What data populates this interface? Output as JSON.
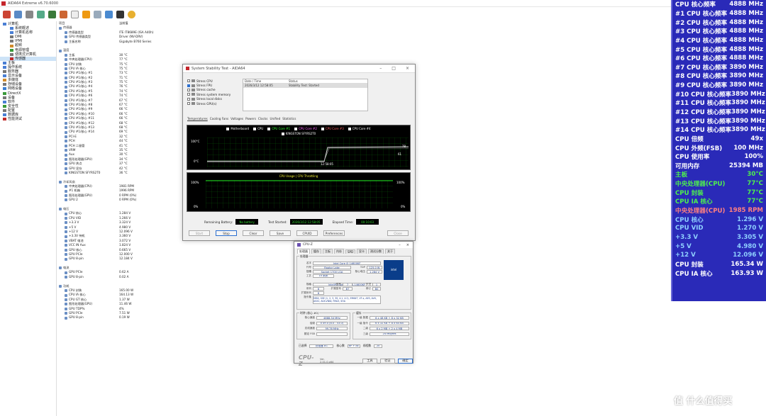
{
  "window": {
    "title": "AIDA64 Extreme v6.70.6000"
  },
  "tree": [
    {
      "label": "计算机",
      "level": 0,
      "color": "#4a7fd4"
    },
    {
      "label": "系统概述",
      "level": 1,
      "color": "#4a7fd4"
    },
    {
      "label": "计算机名称",
      "level": 1,
      "color": "#4a7fd4"
    },
    {
      "label": "DMI",
      "level": 1,
      "color": "#777"
    },
    {
      "label": "IPMI",
      "level": 1,
      "color": "#777"
    },
    {
      "label": "超频",
      "level": 1,
      "color": "#d08a2a"
    },
    {
      "label": "电源管理",
      "level": 1,
      "color": "#3a9a3a"
    },
    {
      "label": "便携式计算机",
      "level": 1,
      "color": "#777"
    },
    {
      "label": "传感器",
      "level": 1,
      "color": "#c02a2a",
      "selected": true
    },
    {
      "label": "主板",
      "level": 0,
      "color": "#4a7fd4"
    },
    {
      "label": "操作系统",
      "level": 0,
      "color": "#4a7fd4"
    },
    {
      "label": "服务器",
      "level": 0,
      "color": "#777"
    },
    {
      "label": "显示设备",
      "level": 0,
      "color": "#4a7fd4"
    },
    {
      "label": "多媒体",
      "level": 0,
      "color": "#d08a2a"
    },
    {
      "label": "存储设备",
      "level": 0,
      "color": "#777"
    },
    {
      "label": "网络设备",
      "level": 0,
      "color": "#3a7fd4"
    },
    {
      "label": "DirectX",
      "level": 0,
      "color": "#3a9a3a"
    },
    {
      "label": "设备",
      "level": 0,
      "color": "#777"
    },
    {
      "label": "软件",
      "level": 0,
      "color": "#4a7fd4"
    },
    {
      "label": "安全性",
      "level": 0,
      "color": "#3a9a3a"
    },
    {
      "label": "配置",
      "level": 0,
      "color": "#777"
    },
    {
      "label": "数据库",
      "level": 0,
      "color": "#4a7fd4"
    },
    {
      "label": "性能测试",
      "level": 0,
      "color": "#c02a2a"
    }
  ],
  "list": {
    "col_headers": [
      "项目",
      "当前值"
    ],
    "rows": [
      {
        "t": "h",
        "l": "传感器"
      },
      {
        "t": "r",
        "l": "传感器类型",
        "v": "ITE IT8689E (ISA A40h)"
      },
      {
        "t": "r",
        "l": "GPU 传感器类型",
        "v": "Driver (NV-DRV)"
      },
      {
        "t": "r",
        "l": "主板名称",
        "v": "Gigabyte B760 Series"
      },
      {
        "t": "s"
      },
      {
        "t": "h",
        "l": "温度"
      },
      {
        "t": "r",
        "l": "主板",
        "v": "30 °C"
      },
      {
        "t": "r",
        "l": "中央处理器(CPU)",
        "v": "77 °C"
      },
      {
        "t": "r",
        "l": "CPU 封装",
        "v": "75 °C"
      },
      {
        "t": "r",
        "l": "CPU IA 核心",
        "v": "75 °C"
      },
      {
        "t": "r",
        "l": "CPU #1/核心 #1",
        "v": "73 °C"
      },
      {
        "t": "r",
        "l": "CPU #1/核心 #2",
        "v": "71 °C"
      },
      {
        "t": "r",
        "l": "CPU #1/核心 #3",
        "v": "75 °C"
      },
      {
        "t": "r",
        "l": "CPU #1/核心 #4",
        "v": "76 °C"
      },
      {
        "t": "r",
        "l": "CPU #1/核心 #5",
        "v": "74 °C"
      },
      {
        "t": "r",
        "l": "CPU #1/核心 #6",
        "v": "74 °C"
      },
      {
        "t": "r",
        "l": "CPU #1/核心 #7",
        "v": "67 °C"
      },
      {
        "t": "r",
        "l": "CPU #1/核心 #8",
        "v": "67 °C"
      },
      {
        "t": "r",
        "l": "CPU #1/核心 #9",
        "v": "66 °C"
      },
      {
        "t": "r",
        "l": "CPU #1/核心 #10",
        "v": "66 °C"
      },
      {
        "t": "r",
        "l": "CPU #1/核心 #11",
        "v": "66 °C"
      },
      {
        "t": "r",
        "l": "CPU #1/核心 #12",
        "v": "68 °C"
      },
      {
        "t": "r",
        "l": "CPU #1/核心 #13",
        "v": "68 °C"
      },
      {
        "t": "r",
        "l": "CPU #1/核心 #14",
        "v": "69 °C"
      },
      {
        "t": "r",
        "l": "PCI-E",
        "v": "32 °C"
      },
      {
        "t": "r",
        "l": "PCH",
        "v": "44 °C"
      },
      {
        "t": "r",
        "l": "PCH 二极管",
        "v": "41 °C"
      },
      {
        "t": "r",
        "l": "VRM",
        "v": "35 °C"
      },
      {
        "t": "r",
        "l": "Aux",
        "v": "30 °C"
      },
      {
        "t": "r",
        "l": "图形处理器(GPU)",
        "v": "34 °C"
      },
      {
        "t": "r",
        "l": "GPU 热点",
        "v": "37 °C"
      },
      {
        "t": "r",
        "l": "GPU 显存",
        "v": "42 °C"
      },
      {
        "t": "r",
        "l": "KINGSTON SFYRS2T0",
        "v": "36 °C"
      },
      {
        "t": "s"
      },
      {
        "t": "h",
        "l": "冷却风扇"
      },
      {
        "t": "r",
        "l": "中央处理器(CPU)",
        "v": "1981 RPM"
      },
      {
        "t": "r",
        "l": "#1 机箱",
        "v": "1996 RPM"
      },
      {
        "t": "r",
        "l": "图形处理器(GPU)",
        "v": "0 RPM  (0%)"
      },
      {
        "t": "r",
        "l": "GPU 2",
        "v": "0 RPM  (0%)"
      },
      {
        "t": "s"
      },
      {
        "t": "h",
        "l": "电压"
      },
      {
        "t": "r",
        "l": "CPU 核心",
        "v": "1.284 V"
      },
      {
        "t": "r",
        "l": "CPU VID",
        "v": "1.266 V"
      },
      {
        "t": "r",
        "l": "+3.3 V",
        "v": "3.324 V"
      },
      {
        "t": "r",
        "l": "+5 V",
        "v": "4.980 V"
      },
      {
        "t": "r",
        "l": "+12 V",
        "v": "12.096 V"
      },
      {
        "t": "r",
        "l": "+3.3V 待机",
        "v": "3.360 V"
      },
      {
        "t": "r",
        "l": "VBAT 电池",
        "v": "3.072 V"
      },
      {
        "t": "r",
        "l": "VCC IN Aux",
        "v": "1.824 V"
      },
      {
        "t": "r",
        "l": "GPU 核心",
        "v": "0.665 V"
      },
      {
        "t": "r",
        "l": "GPU PCIe",
        "v": "12.000 V"
      },
      {
        "t": "r",
        "l": "GPU 8-pin",
        "v": "12.184 V"
      },
      {
        "t": "s"
      },
      {
        "t": "h",
        "l": "电流"
      },
      {
        "t": "r",
        "l": "GPU PCIe",
        "v": "0.62 A"
      },
      {
        "t": "r",
        "l": "GPU 8-pin",
        "v": "0.02 A"
      },
      {
        "t": "s"
      },
      {
        "t": "h",
        "l": "功耗"
      },
      {
        "t": "r",
        "l": "CPU 封装",
        "v": "165.00 W"
      },
      {
        "t": "r",
        "l": "CPU IA 核心",
        "v": "164.13 W"
      },
      {
        "t": "r",
        "l": "CPU GT 核心",
        "v": "1.37 W"
      },
      {
        "t": "r",
        "l": "图形处理器(GPU)",
        "v": "11.46 W"
      },
      {
        "t": "r",
        "l": "GPU TDP%",
        "v": "4%"
      },
      {
        "t": "r",
        "l": "GPU PCIe",
        "v": "7.51 W"
      },
      {
        "t": "r",
        "l": "GPU 8-pin",
        "v": "0.19 W"
      }
    ]
  },
  "sst": {
    "title": "System Stability Test - AIDA64",
    "options": [
      {
        "label": "Stress CPU",
        "on": false
      },
      {
        "label": "Stress FPU",
        "on": true
      },
      {
        "label": "Stress cache",
        "on": false
      },
      {
        "label": "Stress system memory",
        "on": false
      },
      {
        "label": "Stress local disks",
        "on": false
      },
      {
        "label": "Stress GPU(s)",
        "on": false
      }
    ],
    "log_headers": [
      "Date / Time",
      "Status"
    ],
    "log_rows": [
      {
        "d": "2026/3/12 12:58:05",
        "s": "Stability Test: Started"
      }
    ],
    "tabs": [
      "Temperatures",
      "Cooling Fans",
      "Voltages",
      "Powers",
      "Clocks",
      "Unified",
      "Statistics"
    ],
    "legend1": [
      "Motherboard",
      "CPU",
      "CPU Core #1",
      "CPU Core #2",
      "CPU Core #3",
      "CPU Core #4"
    ],
    "legend1b": "KINGSTON SFYRS2T0",
    "g1": {
      "ymax": "100°C",
      "ymin": "0°C",
      "time": "12:58:05",
      "r1": "78",
      "r2": "61"
    },
    "legend2": "CPU Usage  |  CPU Throttling",
    "g2": {
      "ymax": "100%",
      "ymin": "0%",
      "rmax": "100%",
      "rmin": "0%"
    },
    "battery_label": "Remaining Battery:",
    "battery": "No battery",
    "started_label": "Test Started:",
    "started": "2026/3/12 12:58:05",
    "elapsed_label": "Elapsed Time:",
    "elapsed": "00:10:03",
    "buttons": [
      "Start",
      "Stop",
      "Clear",
      "Save",
      "CPUID",
      "Preferences",
      "Close"
    ]
  },
  "cpuz": {
    "title": "CPU-Z",
    "tabs": [
      "处理器",
      "缓存",
      "主板",
      "内存",
      "SPD",
      "显卡",
      "测试分数",
      "关于"
    ],
    "proc_label": "处理器",
    "fields": [
      {
        "l": "名字",
        "v": "Intel Core i5 14600KF"
      },
      {
        "l": "代号",
        "v": "Raptor Lake"
      },
      {
        "l": "插槽",
        "v": "Socket 1700 LGA"
      },
      {
        "l": "工艺",
        "v": "10 纳米"
      },
      {
        "l": "规格",
        "v": "Intel(R) Core(TM) i5-14600KF"
      },
      {
        "l": "系列",
        "v": "6"
      },
      {
        "l": "扩展系列",
        "v": "6"
      },
      {
        "l": "指令集",
        "v": "MMX, SSE (1, 2, 3, 3S, 4.1, 4.2), EM64T, VT-x, AES, AVX, AVX2, AVX-VNNI, FMA3, SHA"
      }
    ],
    "tdp_label": "TDP",
    "tdp": "125.0 W",
    "voltage_label": "核心电压",
    "voltage": "1.284 V",
    "model_label": "型号",
    "model": "7",
    "stepping_label": "步进",
    "stepping": "1",
    "extmodel_label": "扩展型号",
    "extmodel": "B7",
    "rev_label": "修订",
    "rev": "B0",
    "clock_header": "时钟 (核心 #0)",
    "clocks": [
      {
        "l": "核心速度",
        "v": "4888.34 MHz"
      },
      {
        "l": "倍频",
        "v": "x 49.0 (8.0 - 53.0)"
      },
      {
        "l": "总线速度",
        "v": "99.76 MHz"
      },
      {
        "l": "额定 FSB",
        "v": ""
      }
    ],
    "cache_header": "缓存",
    "caches": [
      {
        "l": "一级 数据",
        "v": "6 x 48 KB + 8 x 32 KB"
      },
      {
        "l": "一级 指令",
        "v": "6 x 32 KB + 8 x 64 KB"
      },
      {
        "l": "二级",
        "v": "6 x 2 MB + 2 x 4 MB"
      },
      {
        "l": "三级",
        "v": "24 MBytes"
      }
    ],
    "select_label": "已选择",
    "select": "处理器 #1",
    "cores_label": "核心数",
    "cores": "6P + 8E",
    "threads_label": "线程数",
    "threads": "20",
    "brand": "CPU-Z",
    "version": "Ver. 2.01.0.x64",
    "tools": "工具",
    "validate": "验证",
    "ok": "确定"
  },
  "osd": [
    {
      "l": "CPU 核心频率",
      "v": "4888 MHz",
      "c": "#ffffff"
    },
    {
      "l": "#1 CPU 核心频率",
      "v": "4888 MHz",
      "c": "#ffffff"
    },
    {
      "l": "#2 CPU 核心频率",
      "v": "4888 MHz",
      "c": "#ffffff"
    },
    {
      "l": "#3 CPU 核心频率",
      "v": "4888 MHz",
      "c": "#ffffff"
    },
    {
      "l": "#4 CPU 核心频率",
      "v": "4888 MHz",
      "c": "#ffffff"
    },
    {
      "l": "#5 CPU 核心频率",
      "v": "4888 MHz",
      "c": "#ffffff"
    },
    {
      "l": "#6 CPU 核心频率",
      "v": "4888 MHz",
      "c": "#ffffff"
    },
    {
      "l": "#7 CPU 核心频率",
      "v": "3890 MHz",
      "c": "#ffffff"
    },
    {
      "l": "#8 CPU 核心频率",
      "v": "3890 MHz",
      "c": "#ffffff"
    },
    {
      "l": "#9 CPU 核心频率",
      "v": "3890 MHz",
      "c": "#ffffff"
    },
    {
      "l": "#10 CPU 核心频率",
      "v": "3890 MHz",
      "c": "#ffffff"
    },
    {
      "l": "#11 CPU 核心频率",
      "v": "3890 MHz",
      "c": "#ffffff"
    },
    {
      "l": "#12 CPU 核心频率",
      "v": "3890 MHz",
      "c": "#ffffff"
    },
    {
      "l": "#13 CPU 核心频率",
      "v": "3890 MHz",
      "c": "#ffffff"
    },
    {
      "l": "#14 CPU 核心频率",
      "v": "3890 MHz",
      "c": "#ffffff"
    },
    {
      "l": "CPU 倍频",
      "v": "49x",
      "c": "#ffffff"
    },
    {
      "l": "CPU 外频(FSB)",
      "v": "100 MHz",
      "c": "#ffffff"
    },
    {
      "l": "CPU 使用率",
      "v": "100%",
      "c": "#ffffff"
    },
    {
      "l": "可用内存",
      "v": "25394 MB",
      "c": "#ffffff"
    },
    {
      "l": "主板",
      "v": "30°C",
      "c": "#4ef04e"
    },
    {
      "l": "中央处理器(CPU)",
      "v": "77°C",
      "c": "#4ef04e"
    },
    {
      "l": "CPU 封装",
      "v": "77°C",
      "c": "#4ef04e"
    },
    {
      "l": "CPU IA 核心",
      "v": "77°C",
      "c": "#4ef04e"
    },
    {
      "l": "中央处理器(CPU)",
      "v": "1985 RPM",
      "c": "#ff8080"
    },
    {
      "l": "CPU 核心",
      "v": "1.296 V",
      "c": "#8fd0ff"
    },
    {
      "l": "CPU VID",
      "v": "1.270 V",
      "c": "#8fd0ff"
    },
    {
      "l": "+3.3 V",
      "v": "3.305 V",
      "c": "#8fd0ff"
    },
    {
      "l": "+5 V",
      "v": "4.980 V",
      "c": "#8fd0ff"
    },
    {
      "l": "+12 V",
      "v": "12.096 V",
      "c": "#8fd0ff"
    },
    {
      "l": "CPU 封装",
      "v": "165.34 W",
      "c": "#ffffff"
    },
    {
      "l": "CPU IA 核心",
      "v": "163.93 W",
      "c": "#ffffff"
    }
  ],
  "watermark": "值 什么值得买"
}
